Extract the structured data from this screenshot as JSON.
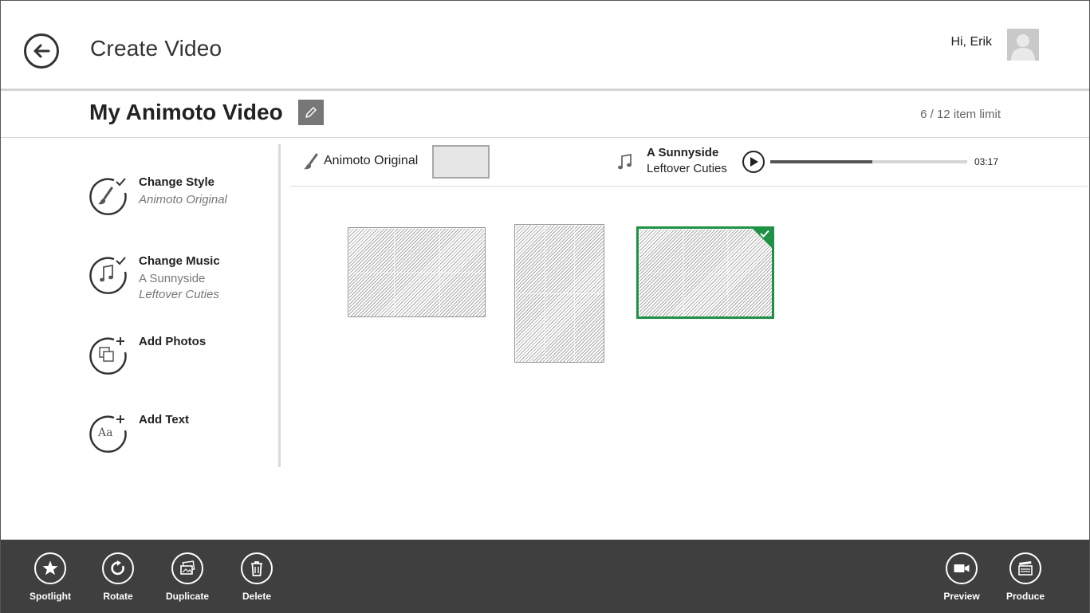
{
  "header": {
    "title": "Create Video",
    "greeting": "Hi, Erik"
  },
  "project": {
    "title": "My Animoto Video",
    "item_limit": "6 / 12 item limit"
  },
  "sidebar": {
    "items": [
      {
        "label": "Change Style",
        "sub1": "Animoto Original",
        "icon": "brush-icon"
      },
      {
        "label": "Change Music",
        "sub1": "A Sunnyside",
        "sub2": "Leftover Cuties",
        "icon": "music-note-icon"
      },
      {
        "label": "Add Photos",
        "icon": "add-photos-icon"
      },
      {
        "label": "Add Text",
        "icon": "add-text-icon",
        "icon_text": "Aa"
      }
    ]
  },
  "style_bar": {
    "style_name": "Animoto Original",
    "song_title": "A Sunnyside",
    "song_artist": "Leftover Cuties",
    "duration": "03:17",
    "progress": 0.52
  },
  "photos": [
    {
      "orientation": "landscape",
      "selected": false
    },
    {
      "orientation": "portrait",
      "selected": false
    },
    {
      "orientation": "landscape",
      "selected": true
    }
  ],
  "appbar": {
    "left": [
      {
        "label": "Spotlight",
        "icon": "star-icon"
      },
      {
        "label": "Rotate",
        "icon": "rotate-icon"
      },
      {
        "label": "Duplicate",
        "icon": "duplicate-icon"
      },
      {
        "label": "Delete",
        "icon": "trash-icon"
      }
    ],
    "right": [
      {
        "label": "Preview",
        "icon": "video-camera-icon"
      },
      {
        "label": "Produce",
        "icon": "clapperboard-icon"
      }
    ]
  },
  "colors": {
    "accent_green": "#1f9145",
    "appbar_bg": "#3f3f3f",
    "edit_button": "#777777"
  }
}
